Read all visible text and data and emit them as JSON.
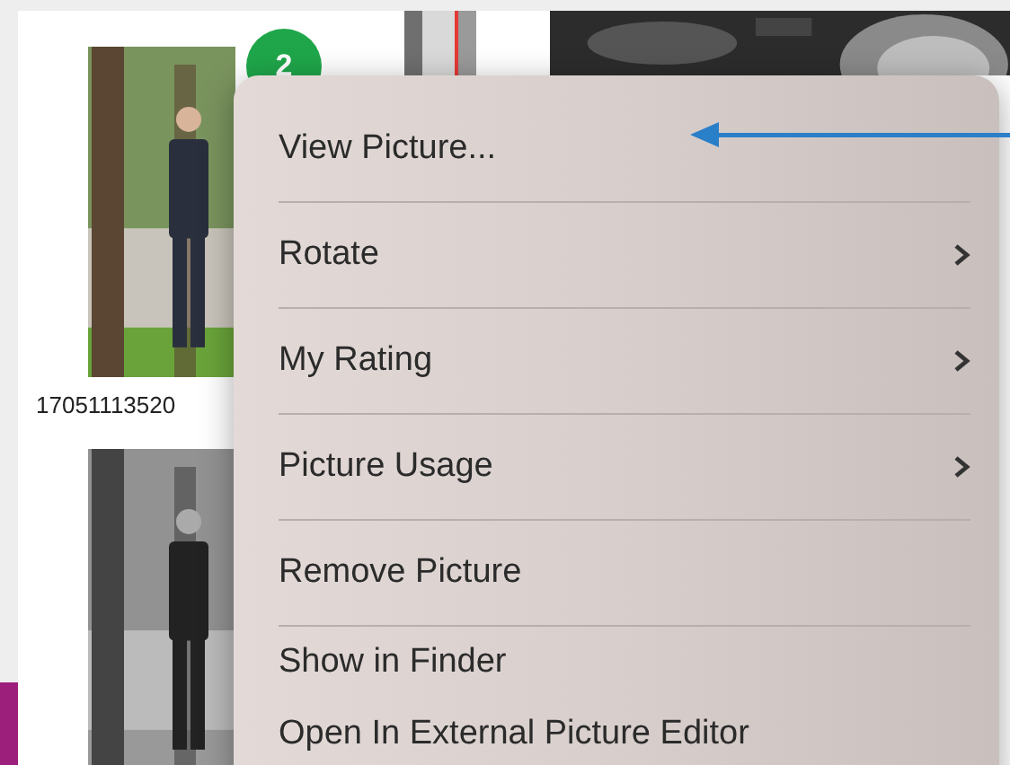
{
  "thumbnails": [
    {
      "badge": "2",
      "caption": "17051113520",
      "kind": "color"
    },
    {
      "kind": "grayscale"
    }
  ],
  "menu": {
    "groups": [
      [
        {
          "label": "View Picture...",
          "submenu": false
        }
      ],
      [
        {
          "label": "Rotate",
          "submenu": true
        }
      ],
      [
        {
          "label": "My Rating",
          "submenu": true
        }
      ],
      [
        {
          "label": "Picture Usage",
          "submenu": true
        }
      ],
      [
        {
          "label": "Remove Picture",
          "submenu": false
        }
      ],
      [
        {
          "label": "Show in Finder",
          "submenu": false
        },
        {
          "label": "Open In External Picture Editor",
          "submenu": false
        }
      ]
    ]
  }
}
